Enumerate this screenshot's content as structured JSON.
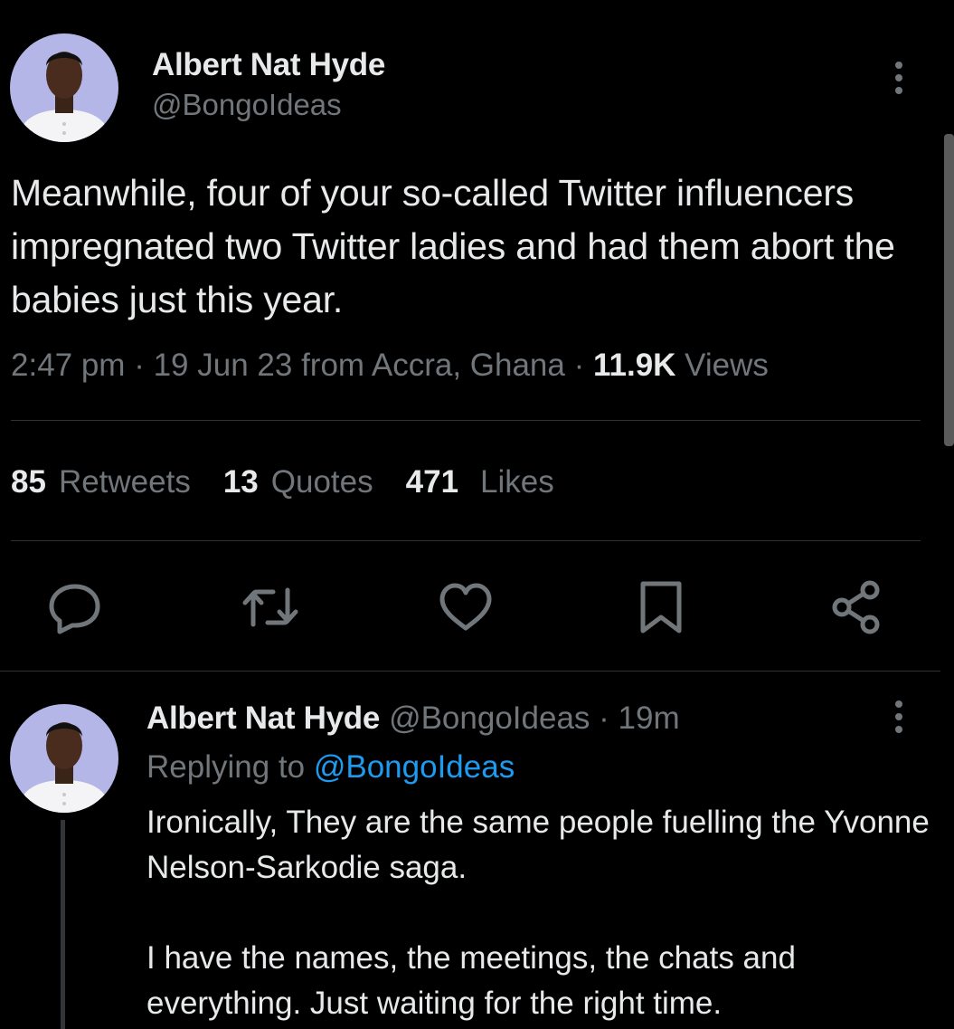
{
  "main_tweet": {
    "author_name": "Albert Nat Hyde",
    "author_handle": "@BongoIdeas",
    "text": "Meanwhile, four of your so-called Twitter influencers impregnated two Twitter ladies and had them abort the babies just this year.",
    "time": "2:47 pm",
    "date": "19 Jun 23",
    "location": "from Accra, Ghana",
    "views_count": "11.9K",
    "views_label": "Views",
    "retweets_count": "85",
    "retweets_label": "Retweets",
    "quotes_count": "13",
    "quotes_label": "Quotes",
    "likes_count": "471",
    "likes_label": "Likes",
    "icons": [
      "more-vertical-icon",
      "reply-icon",
      "retweet-icon",
      "like-icon",
      "bookmark-icon",
      "share-icon"
    ]
  },
  "reply_tweet": {
    "author_name": "Albert Nat Hyde",
    "author_handle": "@BongoIdeas",
    "time_ago": "19m",
    "replying_label": "Replying to",
    "replying_to": "@BongoIdeas",
    "text": "Ironically, They are the same people fuelling the Yvonne Nelson-Sarkodie saga.\n\nI have the names, the meetings, the chats and everything. Just waiting for the right time."
  },
  "colors": {
    "background": "#000000",
    "primary_text": "#e7e9ea",
    "secondary_text": "#71767b",
    "link": "#1d9bf0",
    "divider": "#2f3336",
    "avatar_bg": "#b3b6e6"
  }
}
